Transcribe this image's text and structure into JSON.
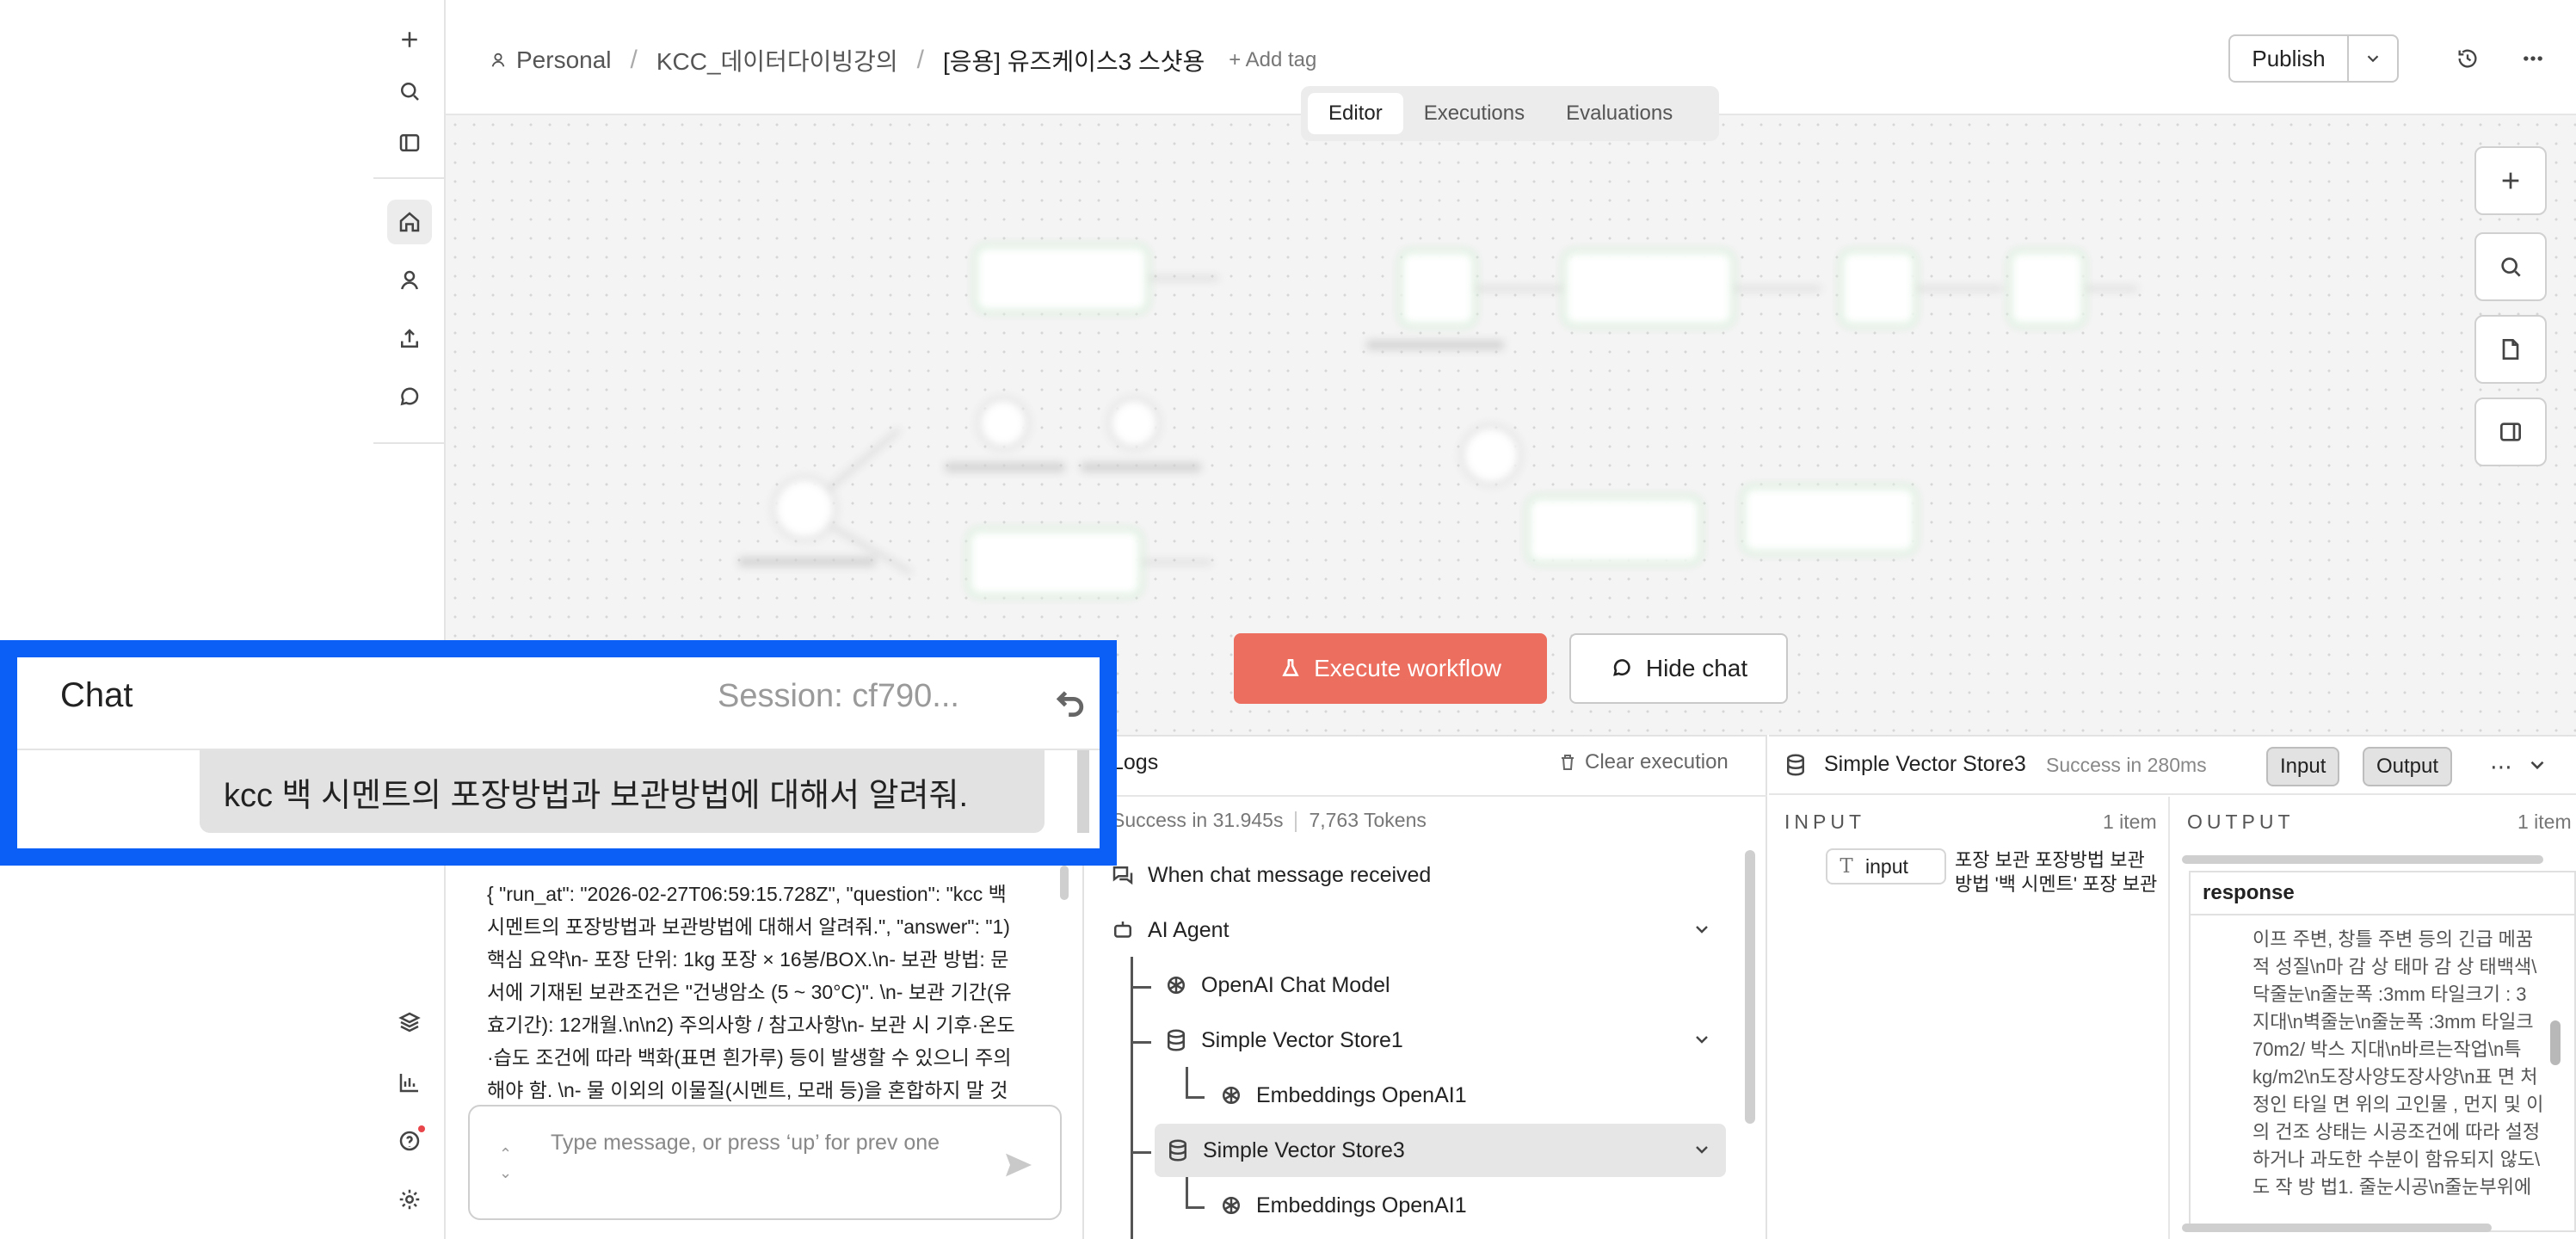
{
  "header": {
    "breadcrumb": {
      "project": "Personal",
      "folder": "KCC_데이터다이빙강의",
      "workflow": "[응용] 유즈케이스3 스샷용"
    },
    "add_tag": "+ Add tag",
    "publish_label": "Publish"
  },
  "tabs": [
    {
      "label": "Editor",
      "active": true
    },
    {
      "label": "Executions",
      "active": false
    },
    {
      "label": "Evaluations",
      "active": false
    }
  ],
  "canvas": {
    "execute_label": "Execute workflow",
    "hide_chat_label": "Hide chat"
  },
  "chat_overlay": {
    "title": "Chat",
    "session": "Session: cf790...",
    "user_message": "kcc 백 시멘트의 포장방법과 보관방법에 대해서 알려줘."
  },
  "chat_pane": {
    "json_output": "{ \"run_at\": \"2026-02-27T06:59:15.728Z\", \"question\": \"kcc 백 시멘트의 포장방법과 보관방법에 대해서 알려줘.\", \"answer\": \"1) 핵심 요약\\n- 포장 단위: 1kg 포장 × 16봉/BOX.\\n- 보관 방법: 문서에 기재된 보관조건은 \"건냉암소 (5 ~ 30°C)\". \\n- 보관 기간(유효기간): 12개월.\\n\\n2) 주의사항 / 참고사항\\n- 보관 시 기후·온도·습도 조건에 따라 백화(표면 흰가루) 등이 발생할 수 있으니 주의해야 함. \\n- 물 이외의 이물질(시멘트, 모래 등)을 혼합하지 말 것",
    "input_placeholder": "Type message, or press ‘up’ for prev one"
  },
  "logs": {
    "title": "Logs",
    "clear_label": "Clear execution",
    "status": "Success in 31.945s",
    "tokens": "7,763 Tokens",
    "items": [
      {
        "label": "When chat message received"
      },
      {
        "label": "AI Agent"
      },
      {
        "label": "OpenAI Chat Model"
      },
      {
        "label": "Simple Vector Store1"
      },
      {
        "label": "Embeddings OpenAI1"
      },
      {
        "label": "Simple Vector Store3"
      },
      {
        "label": "Embeddings OpenAI1"
      }
    ]
  },
  "detail": {
    "node_name": "Simple Vector Store3",
    "status": "Success in 280ms",
    "input_btn": "Input",
    "output_btn": "Output",
    "input_label": "INPUT",
    "input_count": "1 item",
    "output_label": "OUTPUT",
    "output_count": "1 item",
    "input_field": "input",
    "input_value": "포장 보관 포장방법 보관방법 '백 시멘트' 포장 보관",
    "response_header": "response",
    "response_lines": [
      "이프 주변, 창틀 주변 등의 긴급 메꿈",
      "적 성질\\n마 감 상 태마 감 상 태백색\\",
      "닥줄눈\\n줄눈폭 :3mm 타일크기 : 3",
      "지대\\n벽줄눈\\n줄눈폭 :3mm 타일크",
      "70m2/ 박스 지대\\n바르는작업\\n특",
      "kg/m2\\n도장사양도장사양\\n표 면 처",
      "정인 타일 면 위의 고인물 , 먼지 및 이",
      "의 건조 상태는 시공조건에 따라 설정",
      "하거나 과도한 수분이 함유되지 않도\\",
      "도 작 방 법1. 줄눈시공\\n줄눈부위에"
    ]
  }
}
